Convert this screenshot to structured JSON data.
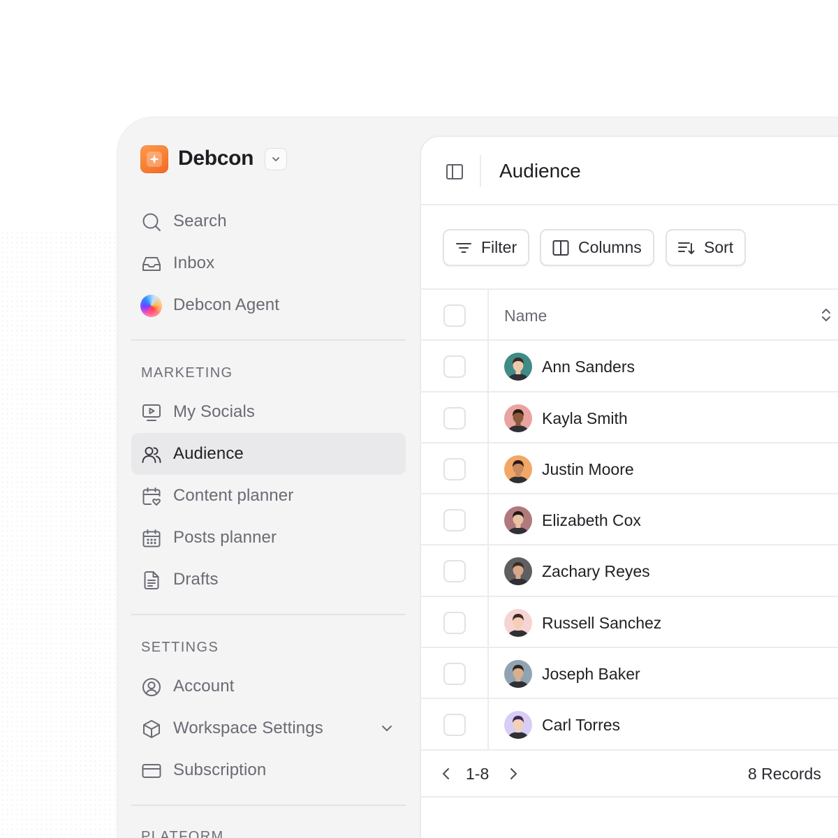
{
  "workspace": {
    "name": "Debcon"
  },
  "nav_top": [
    {
      "label": "Search",
      "icon": "search-icon"
    },
    {
      "label": "Inbox",
      "icon": "inbox-icon"
    },
    {
      "label": "Debcon Agent",
      "icon": "agent-orb-icon"
    }
  ],
  "marketing": {
    "heading": "MARKETING",
    "items": [
      {
        "label": "My Socials",
        "icon": "monitor-play-icon"
      },
      {
        "label": "Audience",
        "icon": "users-icon",
        "active": true
      },
      {
        "label": "Content planner",
        "icon": "calendar-heart-icon"
      },
      {
        "label": "Posts planner",
        "icon": "calendar-grid-icon"
      },
      {
        "label": "Drafts",
        "icon": "document-icon"
      }
    ]
  },
  "settings": {
    "heading": "SETTINGS",
    "items": [
      {
        "label": "Account",
        "icon": "user-circle-icon"
      },
      {
        "label": "Workspace Settings",
        "icon": "cube-icon",
        "has_chevron": true
      },
      {
        "label": "Subscription",
        "icon": "credit-card-icon"
      }
    ]
  },
  "platform": {
    "heading": "PLATFORM"
  },
  "main": {
    "title": "Audience",
    "toolbar": {
      "filter_label": "Filter",
      "columns_label": "Columns",
      "sort_label": "Sort"
    },
    "table": {
      "column_name": "Name",
      "rows": [
        {
          "name": "Ann Sanders",
          "avatar_bg": "#3f8b86",
          "skin": "#f0c9ad",
          "hair": "#3a2a22"
        },
        {
          "name": "Kayla Smith",
          "avatar_bg": "#e9a3a0",
          "skin": "#8a5a3c",
          "hair": "#2b1a12"
        },
        {
          "name": "Justin Moore",
          "avatar_bg": "#f2a766",
          "skin": "#c88a5e",
          "hair": "#2a1c14"
        },
        {
          "name": "Elizabeth Cox",
          "avatar_bg": "#b07a7d",
          "skin": "#e9c2a3",
          "hair": "#1f1715"
        },
        {
          "name": "Zachary Reyes",
          "avatar_bg": "#5f5f61",
          "skin": "#d8a88a",
          "hair": "#3b2c24"
        },
        {
          "name": "Russell Sanchez",
          "avatar_bg": "#f6d4d4",
          "skin": "#f4cfb5",
          "hair": "#3a2b26"
        },
        {
          "name": "Joseph Baker",
          "avatar_bg": "#8fa3b3",
          "skin": "#d9b08f",
          "hair": "#2d241e"
        },
        {
          "name": "Carl Torres",
          "avatar_bg": "#d8cdf4",
          "skin": "#f3d0b8",
          "hair": "#3d2a55"
        }
      ]
    },
    "pagination": {
      "range": "1-8",
      "records": "8 Records"
    }
  },
  "colors": {
    "brand": "#f26a21",
    "active_bg": "#e9e9eb",
    "sidebar_bg": "#f4f4f5"
  }
}
